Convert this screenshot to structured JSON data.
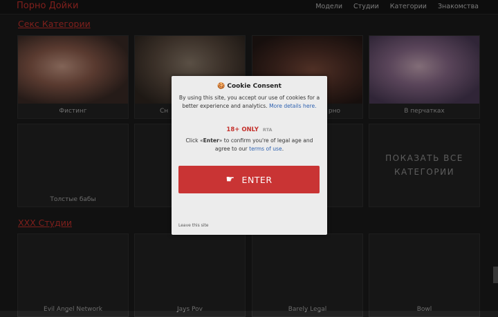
{
  "header": {
    "logo": "Порно Дойки",
    "nav": [
      "Модели",
      "Студии",
      "Категории",
      "Знакомства"
    ]
  },
  "categories_section": {
    "title": "Секс Категории",
    "items": [
      "Фистинг",
      "Сн",
      "рно",
      "В перчатках",
      "Толстые бабы"
    ],
    "show_all": "ПОКАЗАТЬ ВСЕ КАТЕГОРИИ"
  },
  "studios_section": {
    "title": "XXX Студии",
    "items": [
      "Evil Angel Network",
      "Jays Pov",
      "Barely Legal",
      "Bowl"
    ]
  },
  "cookie_modal": {
    "title": "🍪 Cookie Consent",
    "text1": "By using this site, you accept our use of cookies for a better experience and analytics.",
    "more_link": "More details here.",
    "age": "18+ ONLY",
    "rta": "RTA",
    "text2_prefix": "Click «",
    "text2_bold": "Enter",
    "text2_mid": "» to confirm you're of legal age and agree to our",
    "terms_link": "terms of use",
    "enter_label": "ENTER",
    "enter_icon": "hand-pointing-icon",
    "leave": "Leave this site"
  }
}
